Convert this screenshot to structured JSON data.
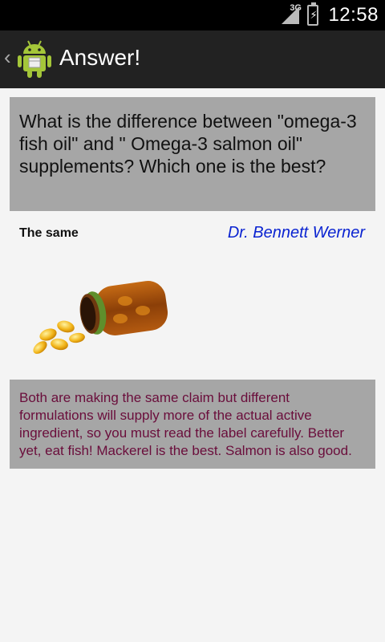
{
  "status": {
    "network": "3G",
    "time": "12:58"
  },
  "action_bar": {
    "title": "Answer!",
    "icon": "android-robot-icon"
  },
  "question": {
    "text": "What is the difference between \"omega-3 fish oil\"  and \" Omega-3 salmon oil\" supplements? Which one is the best?"
  },
  "answer": {
    "title": "The same",
    "author": "Dr. Bennett Werner",
    "image": "supplement-bottle-icon",
    "body": "Both are making the same claim but different formulations will supply more of the actual active ingredient, so you must read the label carefully. Better yet, eat fish! Mackerel is the best. Salmon is also good."
  },
  "colors": {
    "action_bar_bg": "#222222",
    "panel_bg": "#a6a6a6",
    "author_color": "#0a23d1",
    "answer_text": "#6a0d3b"
  }
}
